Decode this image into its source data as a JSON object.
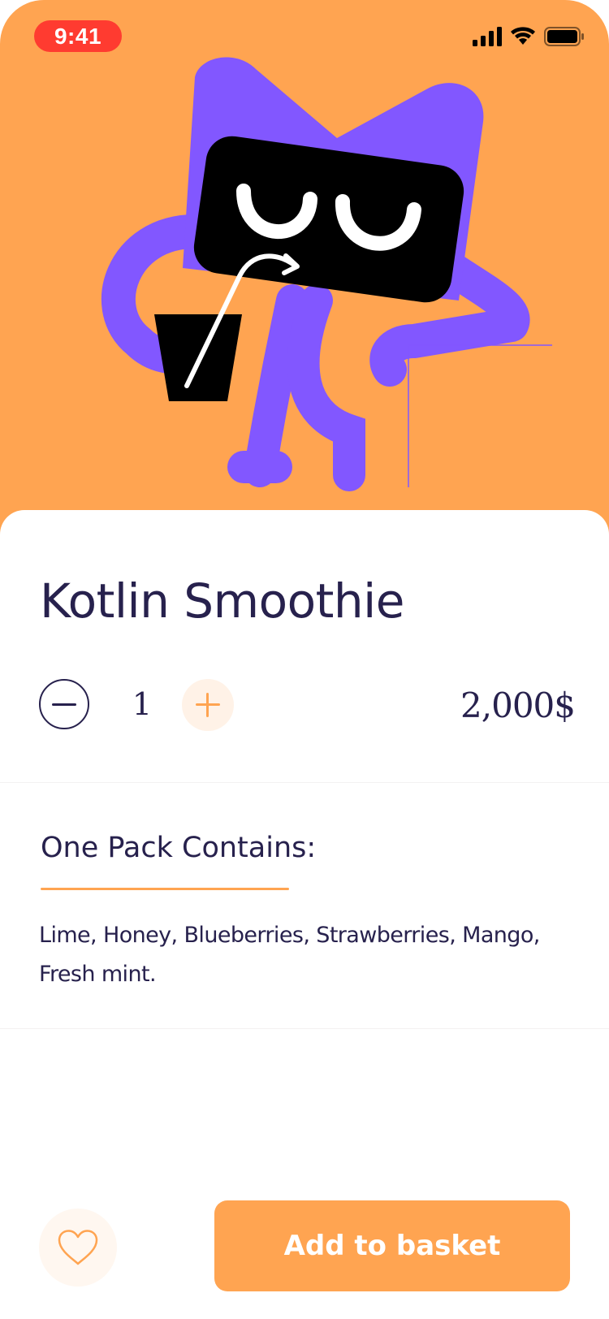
{
  "status_bar": {
    "time": "9:41"
  },
  "hero": {
    "background_color": "#FFA451",
    "illustration": "kotlin-cat-mascot-drinking-smoothie"
  },
  "product": {
    "name": "Kotlin Smoothie",
    "quantity": "1",
    "price": "2,000$"
  },
  "contents": {
    "heading": "One Pack Contains:",
    "ingredients": "Lime, Honey, Blueberries, Strawberries, Mango, Fresh mint."
  },
  "actions": {
    "favorite_icon": "heart-icon",
    "add_to_basket_label": "Add to basket"
  },
  "colors": {
    "accent": "#FFA451",
    "text": "#27214D",
    "mascot": "#8257FF",
    "status_time_pill": "#FF3B30"
  }
}
